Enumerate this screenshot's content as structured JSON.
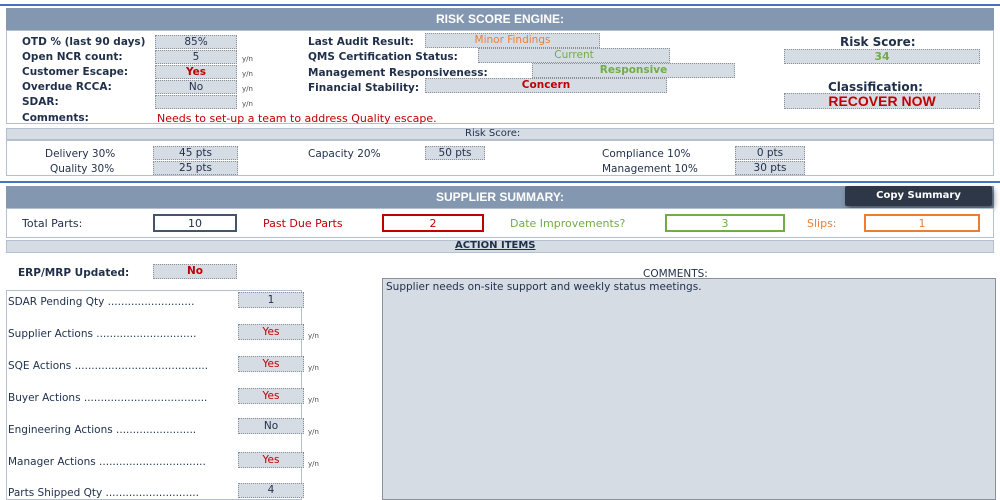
{
  "risk_engine": {
    "title": "RISK SCORE ENGINE:",
    "otd_label": "OTD % (last 90 days)",
    "otd_value": "85%",
    "ncr_label": "Open NCR count:",
    "ncr_value": "5",
    "escape_label": "Customer Escape:",
    "escape_value": "Yes",
    "rcca_label": "Overdue RCCA:",
    "rcca_value": "No",
    "sdar_label": "SDAR:",
    "sdar_value": "",
    "comments_label": "Comments:",
    "comments_value": "Needs to set-up a team to address Quality escape.",
    "yn": "y/n",
    "audit_label": "Last Audit Result:",
    "audit_value": "Minor Findings",
    "qms_label": "QMS Certification Status:",
    "qms_value": "Current",
    "mgmt_label": "Management Responsiveness:",
    "mgmt_value": "Responsive",
    "fin_label": "Financial Stability:",
    "fin_value": "Concern",
    "score_label": "Risk Score:",
    "score_value": "34",
    "class_label": "Classification:",
    "class_value": "RECOVER NOW"
  },
  "risk_score": {
    "title": "Risk Score:",
    "delivery_label": "Delivery 30%",
    "delivery_value": "45 pts",
    "quality_label": "Quality 30%",
    "quality_value": "25 pts",
    "capacity_label": "Capacity 20%",
    "capacity_value": "50 pts",
    "compliance_label": "Compliance 10%",
    "compliance_value": "0 pts",
    "management_label": "Management 10%",
    "management_value": "30 pts"
  },
  "summary": {
    "title": "SUPPLIER SUMMARY:",
    "copy_button": "Copy Summary",
    "total_parts_label": "Total Parts:",
    "total_parts_value": "10",
    "past_due_label": "Past Due Parts",
    "past_due_value": "2",
    "date_impr_label": "Date Improvements?",
    "date_impr_value": "3",
    "slips_label": "Slips:",
    "slips_value": "1"
  },
  "actions": {
    "title": "ACTION ITEMS",
    "erp_label": "ERP/MRP Updated:",
    "erp_value": "No",
    "comments_label": "COMMENTS:",
    "comments_text": "Supplier needs on-site support and weekly status meetings.",
    "yn": "y/n",
    "rows": [
      {
        "label": "SDAR Pending Qty ..........................",
        "value": "1"
      },
      {
        "label": "Supplier Actions ..............................",
        "value": "Yes"
      },
      {
        "label": "SQE Actions ........................................",
        "value": "Yes"
      },
      {
        "label": "Buyer Actions .....................................",
        "value": "Yes"
      },
      {
        "label": "Engineering Actions ........................",
        "value": "No"
      },
      {
        "label": "Manager Actions ................................",
        "value": "Yes"
      },
      {
        "label": "Parts Shipped Qty ............................",
        "value": "4"
      }
    ]
  },
  "colors": {
    "band": "#8497b0",
    "cell": "#d6dce4",
    "red": "#c00000",
    "green": "#70ad47",
    "orange": "#ed7d31",
    "navy": "#1f2f4a"
  }
}
